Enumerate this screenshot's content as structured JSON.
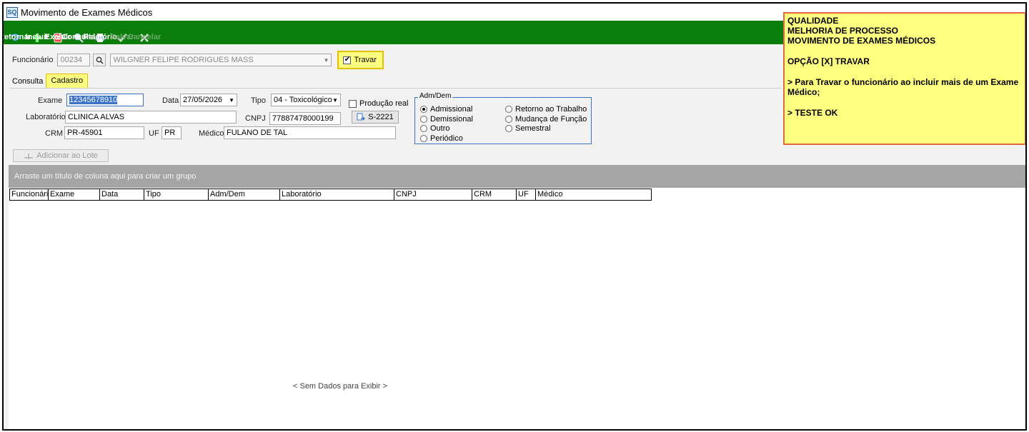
{
  "window": {
    "title": "Movimento de Exames Médicos",
    "icon": "app-logo-icon"
  },
  "toolbar": {
    "items": [
      {
        "label": "Retornar",
        "icon": "return-arrow-icon",
        "enabled": true
      },
      {
        "label": "Incluir",
        "icon": "plus-icon",
        "enabled": true
      },
      {
        "label": "Excluir",
        "icon": "delete-icon",
        "enabled": true
      },
      {
        "label": "Consulta",
        "icon": "magnifier-icon",
        "enabled": true
      },
      {
        "label": "Relatório",
        "icon": "printer-icon",
        "enabled": true
      },
      {
        "label": "Salvar",
        "icon": "checkmark-icon",
        "enabled": false
      },
      {
        "label": "Cancelar",
        "icon": "cancel-x-icon",
        "enabled": false
      }
    ],
    "color": "#0a7d0a"
  },
  "employee": {
    "label": "Funcionário",
    "code": "00234",
    "name": "WILGNER FELIPE RODRIGUES MASS",
    "lock_label": "Travar",
    "lock_checked": true
  },
  "tabs": {
    "consulta": "Consulta",
    "cadastro": "Cadastro",
    "active": "Cadastro"
  },
  "form": {
    "exame_label": "Exame",
    "exame_value": "12345678910",
    "data_label": "Data",
    "data_value": "27/05/2026",
    "tipo_label": "Tipo",
    "tipo_value": "04 - Toxicológico",
    "producao_label": "Produção real",
    "laboratorio_label": "Laboratório",
    "laboratorio_value": "CLINICA ALVAS",
    "cnpj_label": "CNPJ",
    "cnpj_value": "77887478000199",
    "s2221_label": "S-2221",
    "crm_label": "CRM",
    "crm_value": "PR-45901",
    "uf_label": "UF",
    "uf_value": "PR",
    "medico_label": "Médico",
    "medico_value": "FULANO DE TAL"
  },
  "adm_dem": {
    "title": "Adm/Dem",
    "options": [
      "Admissional",
      "Demissional",
      "Outro",
      "Periódico",
      "Retorno ao Trabalho",
      "Mudança de Função",
      "Semestral"
    ],
    "selected": "Admissional"
  },
  "add_lote": "Adicionar ao Lote",
  "grid": {
    "group_hint": "Arraste um título de coluna aqui para criar um grupo",
    "columns": [
      "Funcionário",
      "Exame",
      "Data",
      "Tipo",
      "Adm/Dem",
      "Laboratório",
      "CNPJ",
      "CRM",
      "UF",
      "Médico"
    ],
    "empty_text": "< Sem Dados para Exibir >"
  },
  "note": {
    "lines": [
      "QUALIDADE",
      "MELHORIA DE PROCESSO",
      "MOVIMENTO DE EXAMES MÉDICOS",
      "",
      "OPÇÃO [X] TRAVAR",
      "",
      "> Para Travar o funcionário ao incluir mais de um Exame Médico;",
      "",
      "> TESTE OK"
    ],
    "background": "#ffff80",
    "border": "#e06a3c"
  }
}
